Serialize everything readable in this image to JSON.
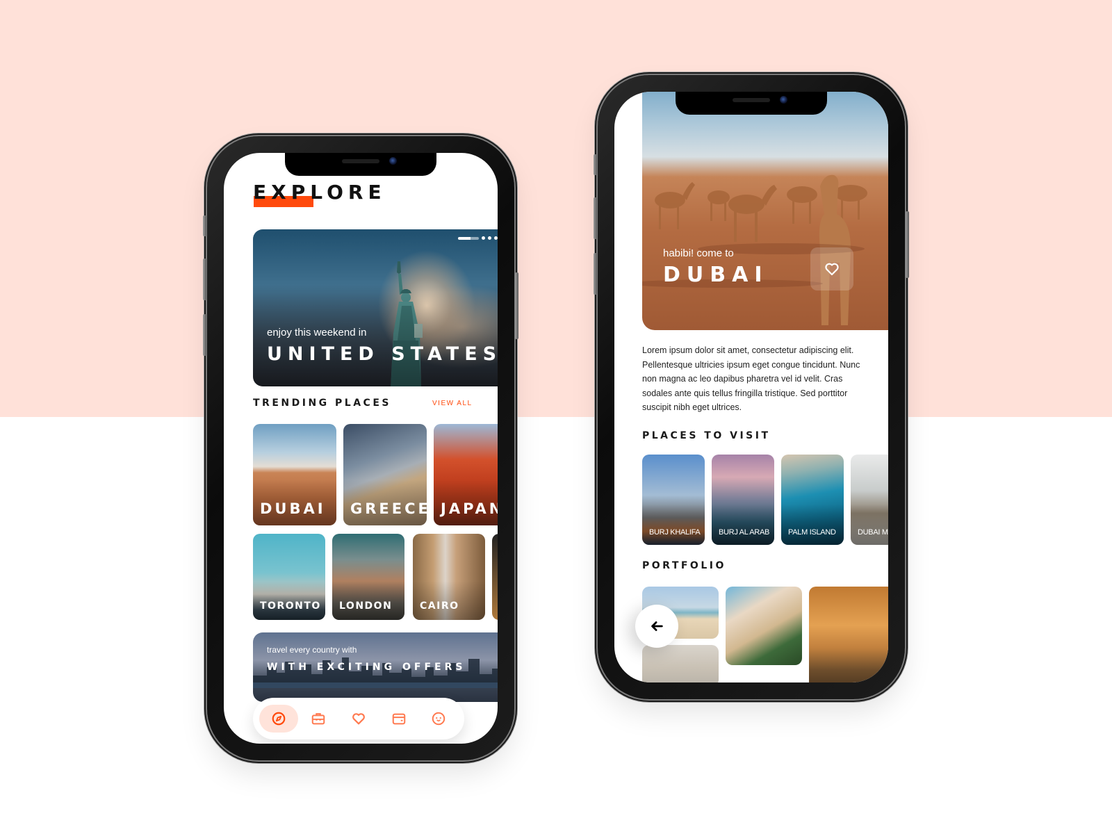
{
  "colors": {
    "accent": "#ff4a0c",
    "accent_soft": "#ffe3da",
    "nav_icon": "#ff7a50",
    "bg_top": "#ffe1d9",
    "text_dark": "#1a1a1a"
  },
  "explore_screen": {
    "title": "EXPLORE",
    "hero": {
      "subtitle": "enjoy this weekend in",
      "title": "UNITED STATES",
      "carousel": {
        "total": 4,
        "active_index": 0
      }
    },
    "trending": {
      "heading": "TRENDING PLACES",
      "view_all_label": "VIEW ALL",
      "row1": [
        {
          "label": "DUBAI"
        },
        {
          "label": "GREECE"
        },
        {
          "label": "JAPAN"
        }
      ],
      "row2": [
        {
          "label": "TORONTO"
        },
        {
          "label": "LONDON"
        },
        {
          "label": "CAIRO"
        }
      ]
    },
    "offer": {
      "subtitle": "travel every country with",
      "title": "WITH EXCITING OFFERS"
    },
    "bottom_nav": [
      {
        "icon": "compass-icon",
        "name": "explore",
        "active": true
      },
      {
        "icon": "briefcase-icon",
        "name": "trips",
        "active": false
      },
      {
        "icon": "heart-icon",
        "name": "favorites",
        "active": false
      },
      {
        "icon": "wallet-icon",
        "name": "wallet",
        "active": false
      },
      {
        "icon": "smile-icon",
        "name": "profile",
        "active": false
      }
    ]
  },
  "detail_screen": {
    "subtitle": "habibi! come to",
    "title": "DUBAI",
    "favorite_icon": "heart-icon",
    "description": "Lorem ipsum dolor sit amet, consectetur adipiscing elit. Pellentesque ultricies ipsum eget congue tincidunt. Nunc non magna ac leo dapibus pharetra vel id velit. Cras sodales ante quis tellus fringilla tristique. Sed porttitor suscipit nibh eget ultrices.",
    "places_heading": "PLACES TO VISIT",
    "places": [
      {
        "label": "BURJ KHALIFA"
      },
      {
        "label": "BURJ AL ARAB"
      },
      {
        "label": "PALM ISLAND"
      },
      {
        "label": "DUBAI MALL"
      }
    ],
    "portfolio_heading": "PORTFOLIO",
    "back_icon": "arrow-left-icon"
  }
}
